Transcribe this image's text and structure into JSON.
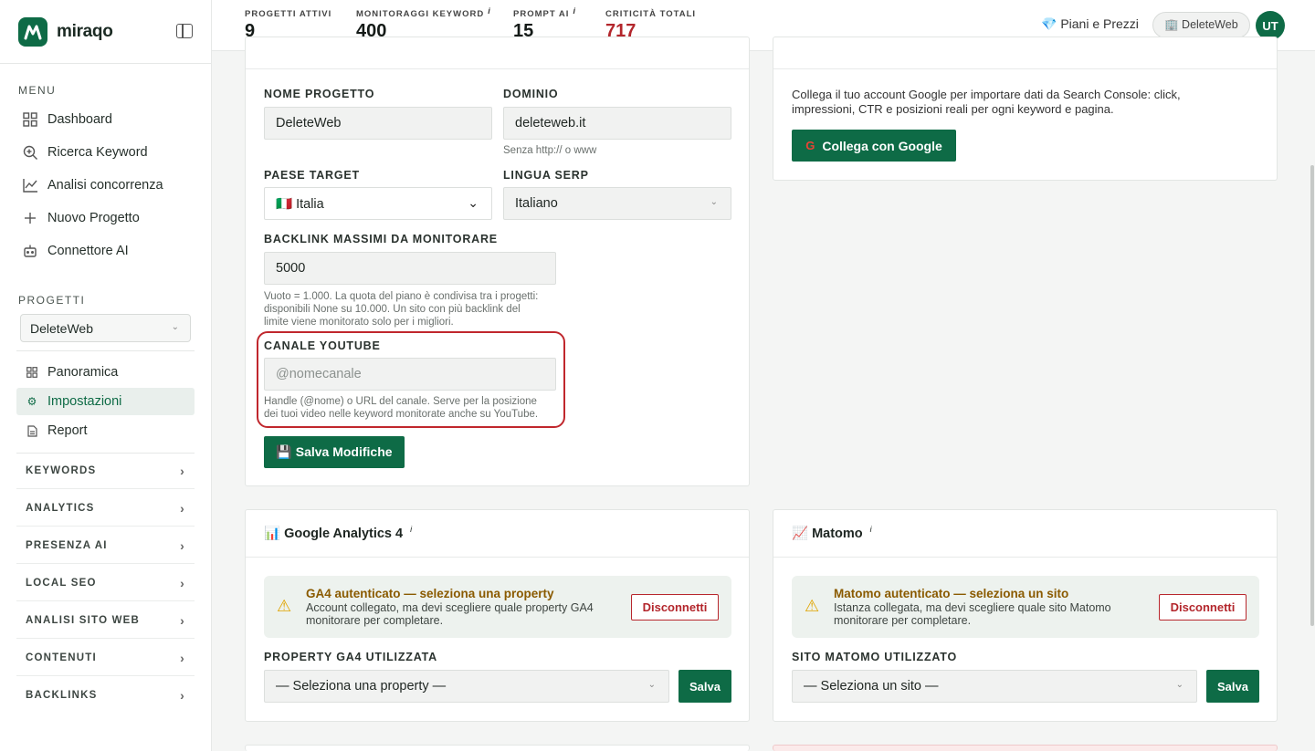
{
  "app": {
    "name": "miraqo"
  },
  "sidebar": {
    "menu_label": "MENU",
    "menu": [
      {
        "label": "Dashboard",
        "icon": "grid-icon"
      },
      {
        "label": "Ricerca Keyword",
        "icon": "search-plus-icon"
      },
      {
        "label": "Analisi concorrenza",
        "icon": "chart-line-icon"
      },
      {
        "label": "Nuovo Progetto",
        "icon": "plus-icon"
      },
      {
        "label": "Connettore AI",
        "icon": "robot-icon"
      }
    ],
    "projects_label": "PROGETTI",
    "project_selected": "DeleteWeb",
    "project_items": [
      {
        "label": "Panoramica",
        "icon": "grid-small-icon"
      },
      {
        "label": "Impostazioni",
        "icon": "gear-icon"
      },
      {
        "label": "Report",
        "icon": "document-icon"
      }
    ],
    "groups": [
      "KEYWORDS",
      "ANALYTICS",
      "PRESENZA AI",
      "LOCAL SEO",
      "ANALISI SITO WEB",
      "CONTENUTI",
      "BACKLINKS"
    ]
  },
  "topbar": {
    "stats": [
      {
        "label": "PROGETTI ATTIVI",
        "value": "9",
        "info": false
      },
      {
        "label": "MONITORAGGI KEYWORD",
        "value": "400",
        "info": true
      },
      {
        "label": "PROMPT AI",
        "value": "15",
        "info": true
      },
      {
        "label": "CRITICITÀ TOTALI",
        "value": "717",
        "info": false
      }
    ],
    "info_glyph": "i",
    "plans_label": "💎 Piani e Prezzi",
    "project_chip": "🏢 DeleteWeb",
    "avatar": "UT"
  },
  "settings": {
    "name_label": "NOME PROGETTO",
    "name_value": "DeleteWeb",
    "domain_label": "DOMINIO",
    "domain_value": "deleteweb.it",
    "domain_hint": "Senza http:// o www",
    "country_label": "PAESE TARGET",
    "country_value": "🇮🇹 Italia",
    "language_label": "LINGUA SERP",
    "language_value": "Italiano",
    "backlink_label": "BACKLINK MASSIMI DA MONITORARE",
    "backlink_value": "5000",
    "backlink_hint_1": "Vuoto = 1.000. La quota del piano è condivisa tra i progetti:",
    "backlink_hint_2": "disponibili None su 10.000. Un sito con più backlink del",
    "backlink_hint_3": "limite viene monitorato solo per i migliori.",
    "youtube_label": "CANALE YOUTUBE",
    "youtube_placeholder": "@nomecanale",
    "youtube_hint_1": "Handle (@nome) o URL del canale. Serve per la posizione",
    "youtube_hint_2": "dei tuoi video nelle keyword monitorate anche su YouTube.",
    "save_label": "💾 Salva Modifiche"
  },
  "search_console": {
    "text_1": "Collega il tuo account Google per importare dati da Search Console: click,",
    "text_2": "impressioni, CTR e posizioni reali per ogni keyword e pagina.",
    "button": "Collega con Google"
  },
  "ga4": {
    "title": "📊 Google Analytics 4",
    "alert_title": "GA4 autenticato — seleziona una property",
    "alert_text_1": "Account collegato, ma devi scegliere quale property GA4",
    "alert_text_2": "monitorare per completare.",
    "disconnect": "Disconnetti",
    "select_label": "PROPERTY GA4 UTILIZZATA",
    "select_value": "— Seleziona una property —",
    "save": "Salva"
  },
  "matomo": {
    "title": "📈 Matomo",
    "alert_title": "Matomo autenticato — seleziona un sito",
    "alert_text_1": "Istanza collegata, ma devi scegliere quale sito Matomo",
    "alert_text_2": "monitorare per completare.",
    "disconnect": "Disconnetti",
    "select_label": "SITO MATOMO UTILIZZATO",
    "select_value": "— Seleziona un sito —",
    "save": "Salva"
  },
  "colors": {
    "brand": "#0e6b46",
    "danger": "#b3262c",
    "warning": "#e0a400"
  }
}
